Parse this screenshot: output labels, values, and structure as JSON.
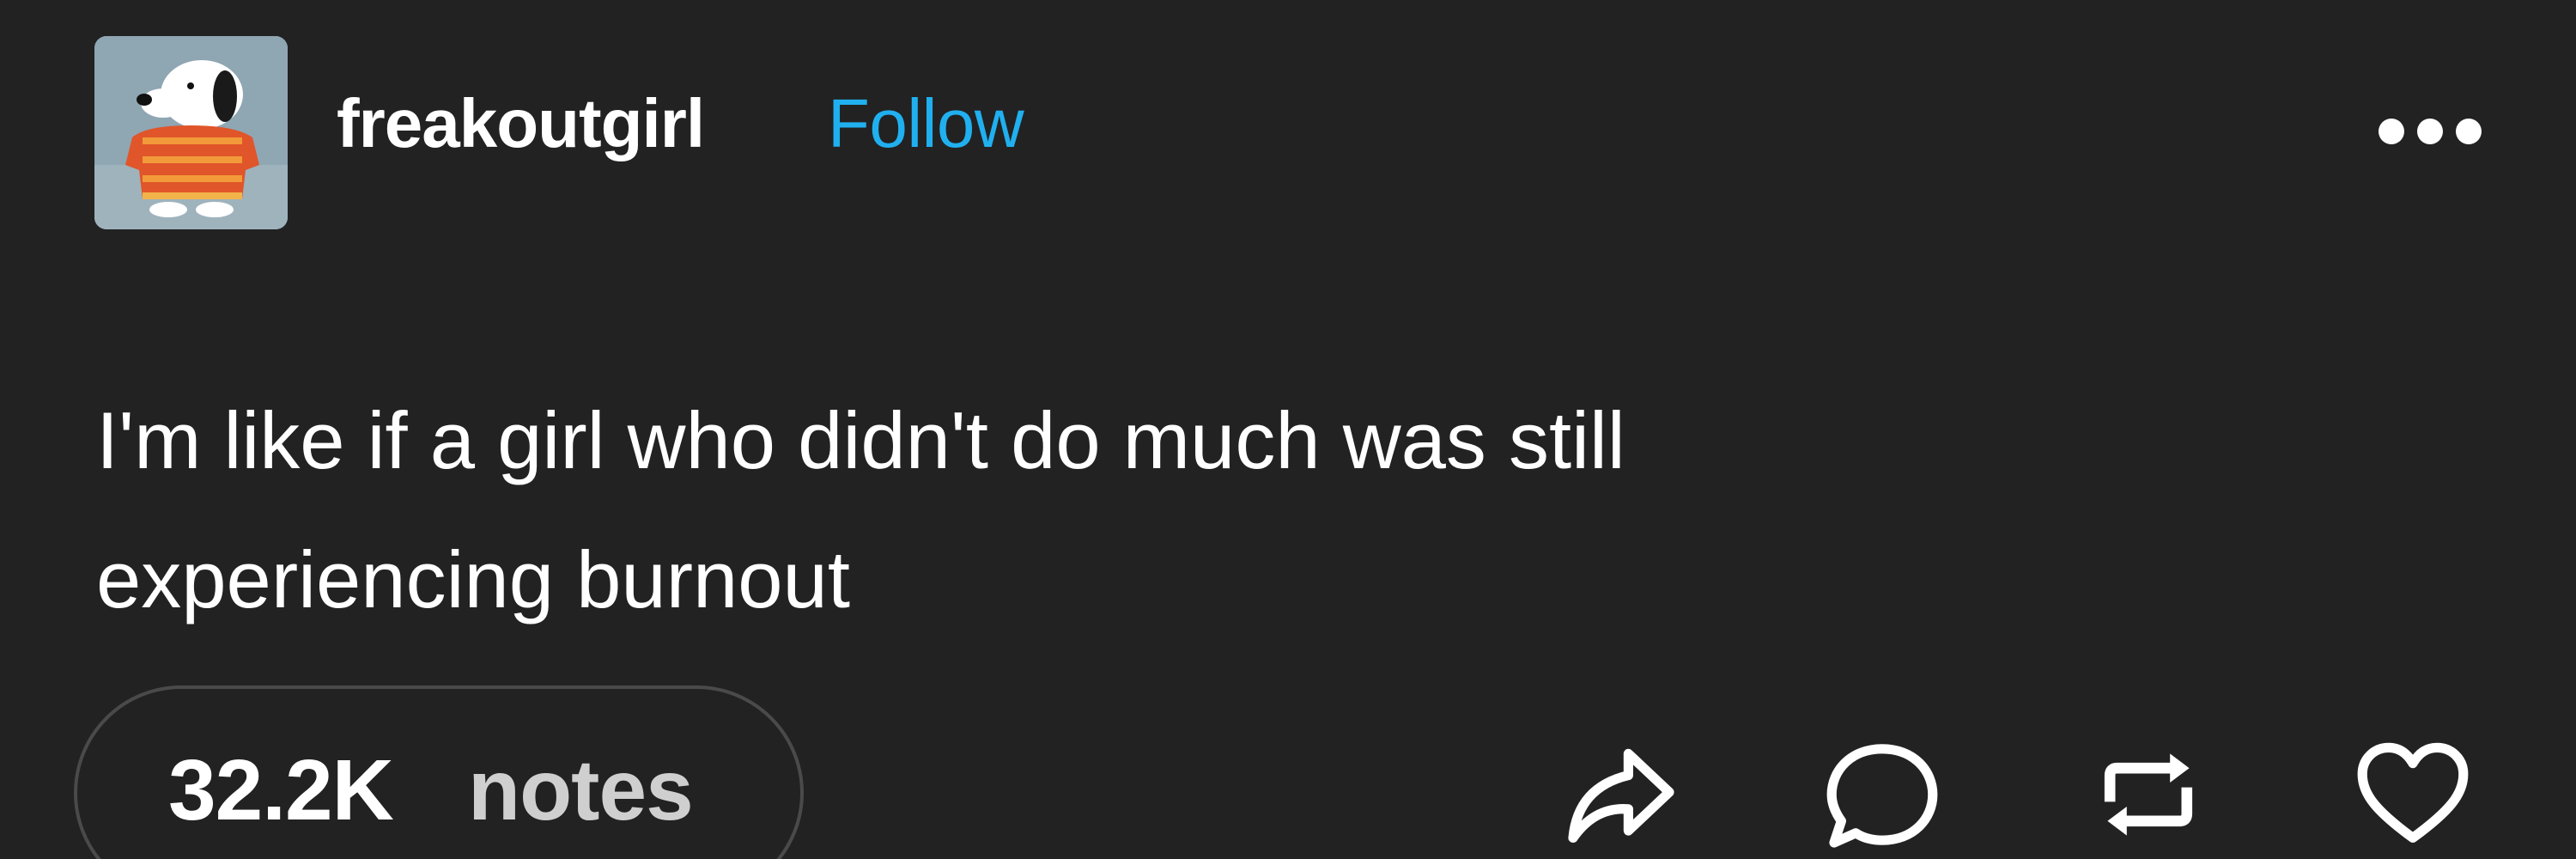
{
  "post": {
    "author": {
      "username": "freakoutgirl",
      "follow_label": "Follow",
      "avatar_icon": "snoopy-avatar"
    },
    "more_icon": "more-horizontal-icon",
    "body_text": "I'm like if a girl who didn't do much was still\nexperiencing burnout",
    "footer": {
      "notes_count": "32.2K",
      "notes_label": "notes",
      "actions": [
        "share-icon",
        "reply-icon",
        "reblog-icon",
        "heart-icon"
      ]
    }
  },
  "colors": {
    "background": "#222222",
    "text": "#ffffff",
    "follow_accent": "#20b0f0",
    "notes_label": "#cfcfcf",
    "pill_border": "#4a4a4a"
  }
}
